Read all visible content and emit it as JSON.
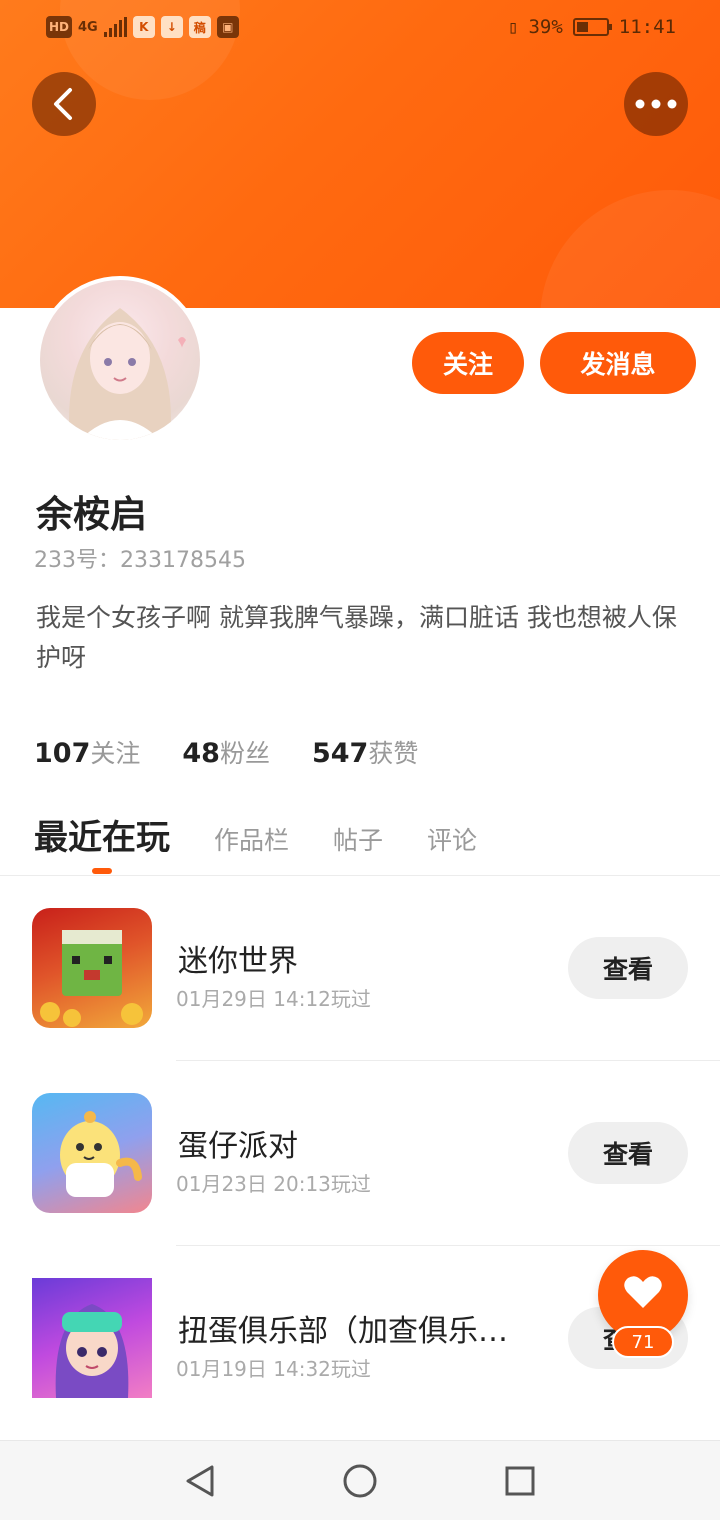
{
  "status_bar": {
    "hd_label": "HD",
    "network_label": "4G",
    "app1_label": "K",
    "app2_label": "↓",
    "app3_label": "稿",
    "battery_percent": "39%",
    "time": "11:41"
  },
  "profile": {
    "username": "余桉启",
    "id_text": "233号：233178545",
    "bio": "我是个女孩子啊 就算我脾气暴躁，满口脏话 我也想被人保护呀",
    "follow_label": "关注",
    "message_label": "发消息"
  },
  "stats": [
    {
      "value": "107",
      "label": "关注"
    },
    {
      "value": "48",
      "label": "粉丝"
    },
    {
      "value": "547",
      "label": "获赞"
    }
  ],
  "tabs": [
    {
      "label": "最近在玩",
      "active": true
    },
    {
      "label": "作品栏",
      "active": false
    },
    {
      "label": "帖子",
      "active": false
    },
    {
      "label": "评论",
      "active": false
    }
  ],
  "games": [
    {
      "name": "迷你世界",
      "time": "01月29日 14:12玩过",
      "button": "查看"
    },
    {
      "name": "蛋仔派对",
      "time": "01月23日 20:13玩过",
      "button": "查看"
    },
    {
      "name": "扭蛋俱乐部（加查俱乐…",
      "time": "01月19日 14:32玩过",
      "button": "查看"
    }
  ],
  "like": {
    "count": "71"
  },
  "colors": {
    "accent": "#ff5a0a",
    "header": "#ff6a10"
  }
}
